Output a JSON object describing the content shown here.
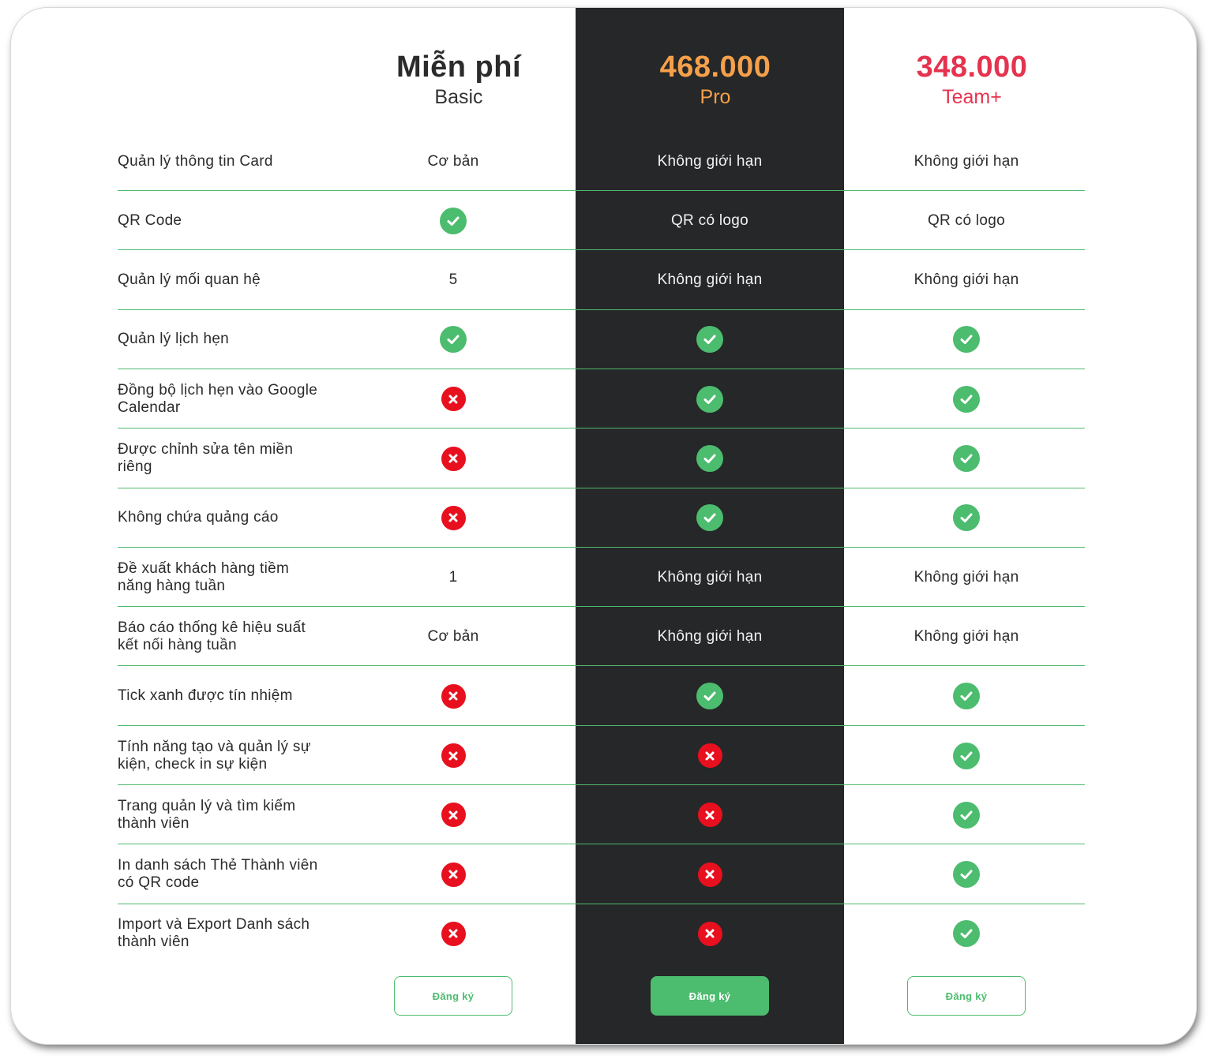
{
  "colors": {
    "accent_green": "#4cbc6e",
    "cross_red": "#e8101e",
    "pro_band": "#262728",
    "pro_price": "#f5a04a",
    "team_price": "#e5334f"
  },
  "plans": [
    {
      "price": "Miễn phí",
      "name": "Basic",
      "button": "Đăng ký",
      "price_color": "#2b2b2b",
      "name_color": "#333333"
    },
    {
      "price": "468.000",
      "name": "Pro",
      "button": "Đăng ký",
      "price_color": "#f5a04a",
      "name_color": "#f5a04a"
    },
    {
      "price": "348.000",
      "name": "Team+",
      "button": "Đăng ký",
      "price_color": "#e5334f",
      "name_color": "#e5334f"
    }
  ],
  "features": [
    {
      "label": "Quản lý thông tin Card",
      "values": [
        "Cơ bản",
        "Không giới hạn",
        "Không giới hạn"
      ]
    },
    {
      "label": "QR Code",
      "values": [
        "check-icon",
        "QR có logo",
        "QR có logo"
      ]
    },
    {
      "label": "Quản lý mối quan hệ",
      "values": [
        "5",
        "Không giới hạn",
        "Không giới hạn"
      ]
    },
    {
      "label": "Quản lý lịch hẹn",
      "values": [
        "check-icon",
        "check-icon",
        "check-icon"
      ]
    },
    {
      "label": "Đồng bộ lịch hẹn vào Google Calendar",
      "values": [
        "cross-icon",
        "check-icon",
        "check-icon"
      ]
    },
    {
      "label": "Được chỉnh sửa tên miền riêng",
      "values": [
        "cross-icon",
        "check-icon",
        "check-icon"
      ]
    },
    {
      "label": "Không chứa quảng cáo",
      "values": [
        "cross-icon",
        "check-icon",
        "check-icon"
      ]
    },
    {
      "label": "Đề xuất khách hàng tiềm năng hàng tuần",
      "values": [
        "1",
        "Không giới hạn",
        "Không giới hạn"
      ]
    },
    {
      "label": "Báo cáo thống kê hiệu suất kết nối hàng tuần",
      "values": [
        "Cơ bản",
        "Không giới hạn",
        "Không giới hạn"
      ]
    },
    {
      "label": "Tick xanh được tín nhiệm",
      "values": [
        "cross-icon",
        "check-icon",
        "check-icon"
      ]
    },
    {
      "label": "Tính năng tạo và quản lý sự kiện, check in sự kiện",
      "values": [
        "cross-icon",
        "cross-icon",
        "check-icon"
      ]
    },
    {
      "label": "Trang quản lý và tìm kiếm thành viên",
      "values": [
        "cross-icon",
        "cross-icon",
        "check-icon"
      ]
    },
    {
      "label": "In danh sách Thẻ Thành viên có QR code",
      "values": [
        "cross-icon",
        "cross-icon",
        "check-icon"
      ]
    },
    {
      "label": "Import và Export Danh sách thành viên",
      "values": [
        "cross-icon",
        "cross-icon",
        "check-icon"
      ]
    }
  ]
}
